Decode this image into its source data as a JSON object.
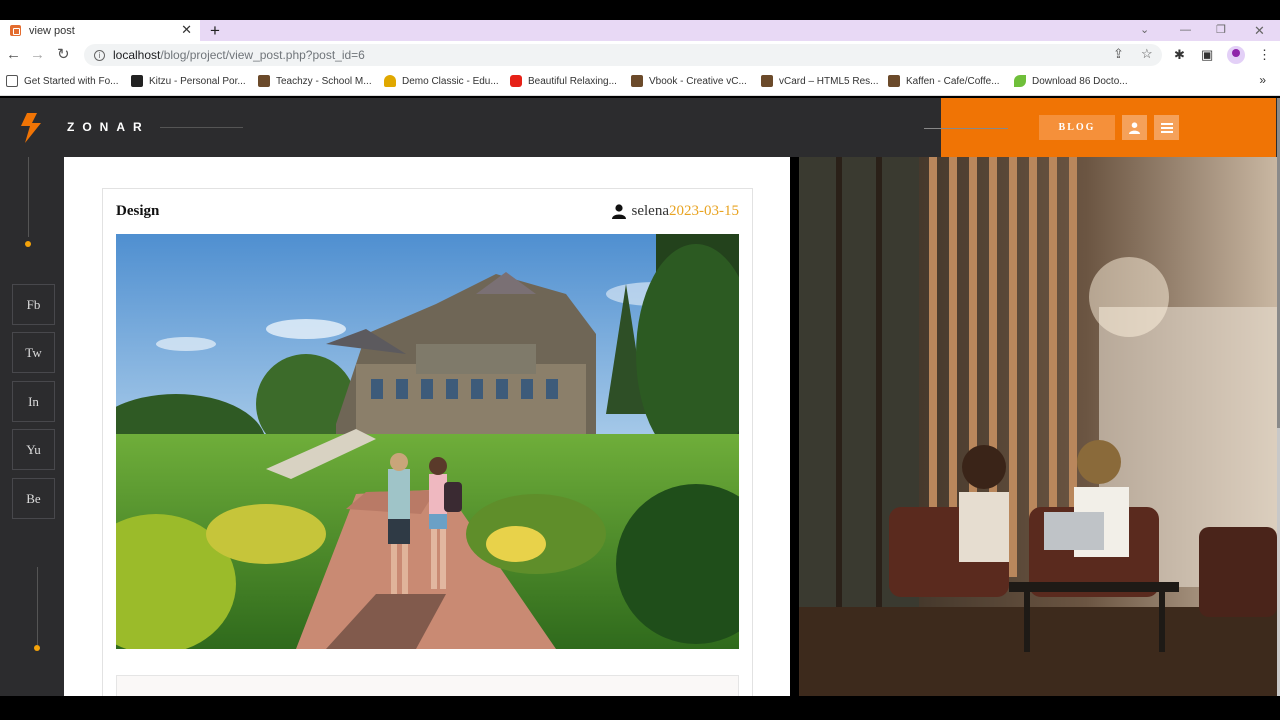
{
  "browser": {
    "tab_title": "view post",
    "url_host": "localhost",
    "url_path": "/blog/project/view_post.php?post_id=6",
    "bookmarks": [
      {
        "label": "Get Started with Fo...",
        "icon": "firebase-icon",
        "color": "#555"
      },
      {
        "label": "Kitzu - Personal Por...",
        "icon": "site-icon",
        "color": "#222"
      },
      {
        "label": "Teachzy - School M...",
        "icon": "site-icon",
        "color": "#6b4a2a"
      },
      {
        "label": "Demo Classic - Edu...",
        "icon": "graduation-icon",
        "color": "#e0a800"
      },
      {
        "label": "Beautiful Relaxing...",
        "icon": "youtube-icon",
        "color": "#e62117"
      },
      {
        "label": "Vbook - Creative vC...",
        "icon": "site-icon",
        "color": "#6b4a2a"
      },
      {
        "label": "vCard – HTML5 Res...",
        "icon": "site-icon",
        "color": "#6b4a2a"
      },
      {
        "label": "Kaffen - Cafe/Coffe...",
        "icon": "site-icon",
        "color": "#6b4a2a"
      },
      {
        "label": "Download 86 Docto...",
        "icon": "leaf-icon",
        "color": "#6fbf3a"
      }
    ],
    "bookmarks_more": "»"
  },
  "site": {
    "logo_text": "ZONAR",
    "blog_button": "BLOG",
    "accent_color": "#f07405"
  },
  "social": [
    "Fb",
    "Tw",
    "In",
    "Yu",
    "Be"
  ],
  "post": {
    "category": "Design",
    "author": "selena",
    "date": "2023-03-15"
  }
}
